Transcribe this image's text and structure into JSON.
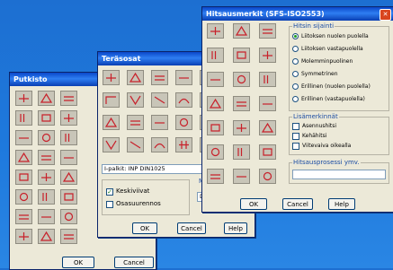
{
  "putkisto": {
    "title": "Putkisto",
    "ok_label": "OK",
    "cancel_label": "Cancel"
  },
  "teras": {
    "title": "Teräsosat",
    "profile_value": "I-palkit: INP DIN1025",
    "checkbox_keskiviivat": "Keskiviivat",
    "checkbox_osasuurennos": "Osasuurennos",
    "partial_label": "Me",
    "partial_input": "Di",
    "ok_label": "OK",
    "cancel_label": "Cancel",
    "help_label": "Help"
  },
  "hitsi": {
    "title": "Hitsausmerkit (SFS-ISO2553)",
    "close_glyph": "✕",
    "group_sijainti": "Hitsin sijainti",
    "radios": [
      "Liitoksen nuolen puolella",
      "Liitoksen vastapuolella",
      "Molemminpuolinen",
      "Symmetrinen",
      "Erillinen (nuolen puolella)",
      "Erillinen (vastapuolella)"
    ],
    "group_lisamerkinnat": "Lisämerkinnät",
    "checks": [
      "Asennushitsi",
      "Kehähitsi",
      "Viitevaiva oikealla"
    ],
    "group_menetelma": "Hitsausprosessi ymv.",
    "ok_label": "OK",
    "cancel_label": "Cancel",
    "help_label": "Help"
  },
  "colors": {
    "accent": "#0a47c9",
    "desktop": "#1e79dd",
    "dialog": "#ece9d8",
    "symbol": "#c8202a"
  }
}
